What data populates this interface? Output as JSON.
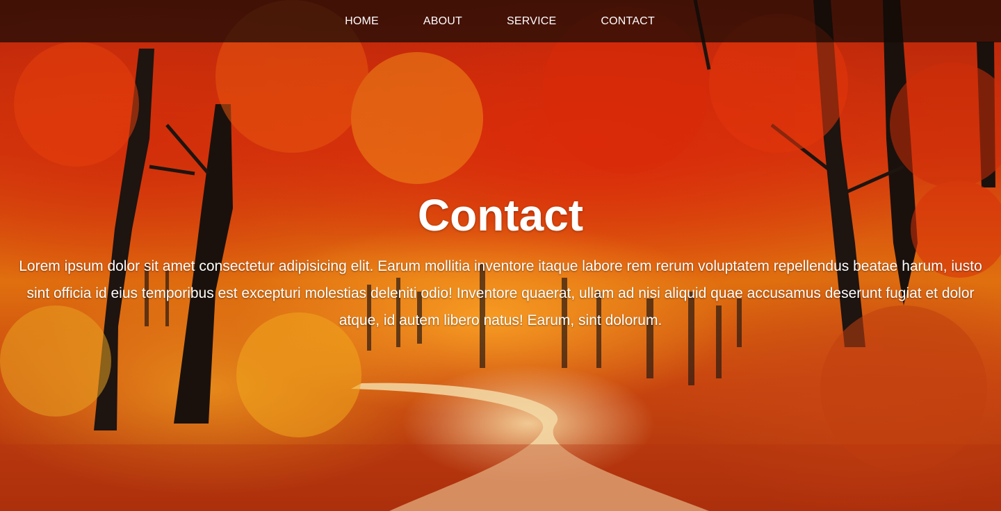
{
  "nav": {
    "items": [
      {
        "label": "HOME"
      },
      {
        "label": "ABOUT"
      },
      {
        "label": "SERVICE"
      },
      {
        "label": "CONTACT"
      }
    ]
  },
  "hero": {
    "title": "Contact",
    "text": "Lorem ipsum dolor sit amet consectetur adipisicing elit. Earum mollitia inventore itaque labore rem rerum voluptatem repellendus beatae harum, iusto sint officia id eius temporibus est excepturi molestias deleniti odio! Inventore quaerat, ullam ad nisi aliquid quae accusamus deserunt fugiat et dolor atque, id autem libero natus! Earum, sint dolorum.",
    "background": "autumn-forest-photo"
  },
  "colors": {
    "navbar_bg": "#140a05",
    "text": "#ffffff",
    "foliage": "#d2380c"
  }
}
